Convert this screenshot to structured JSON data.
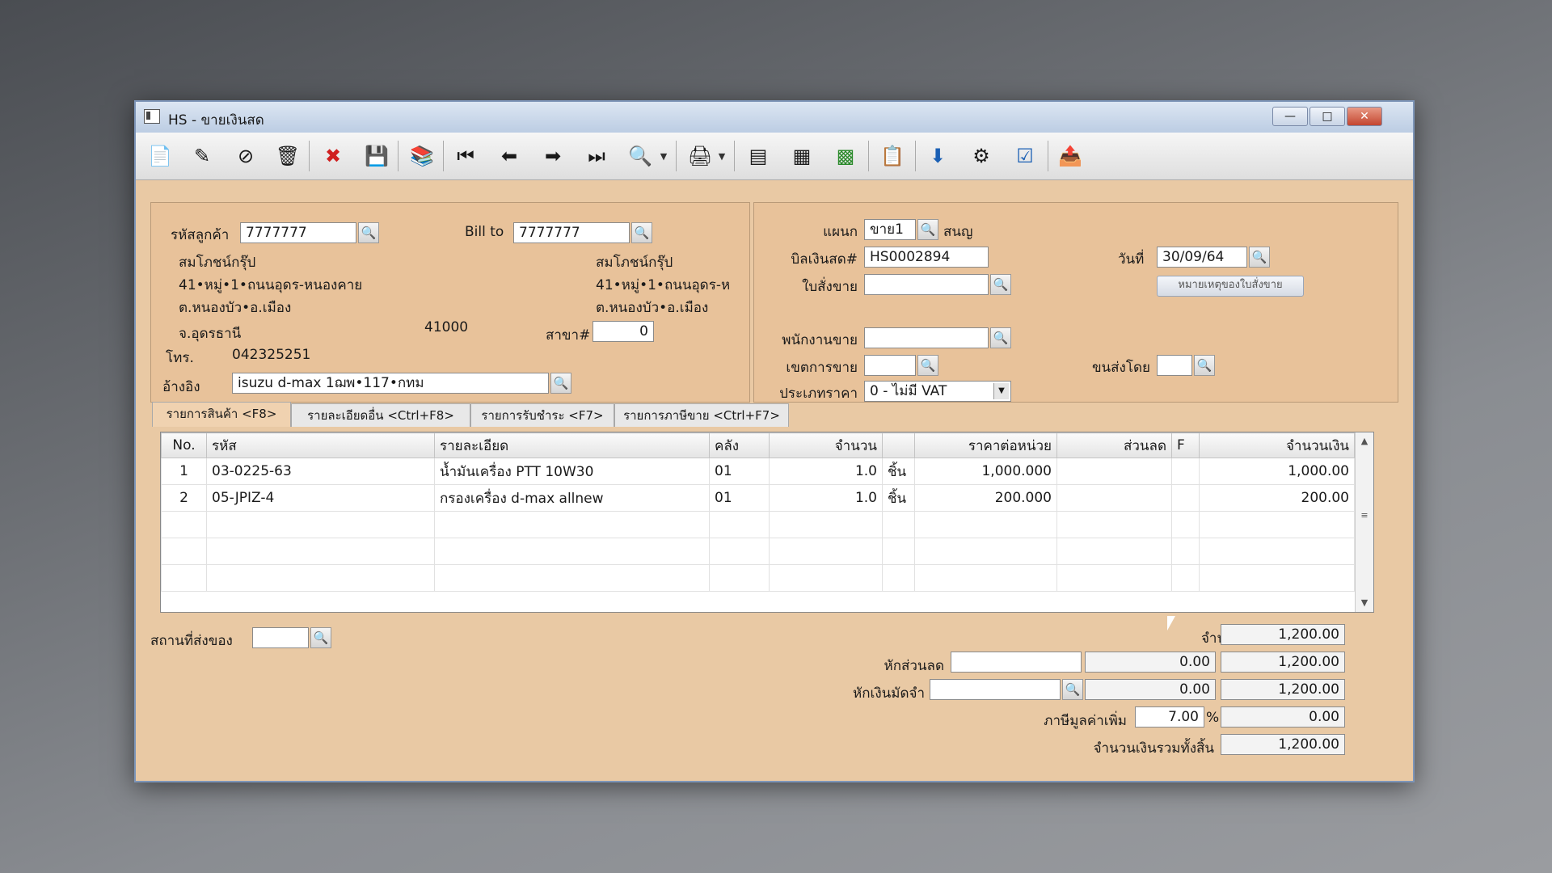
{
  "window": {
    "title": "HS - ขายเงินสด",
    "minimize": "—",
    "maximize": "□",
    "close": "✕"
  },
  "toolbar": {
    "icons": [
      "new-doc-icon",
      "edit-icon",
      "void-icon",
      "delete-icon",
      "cancel-icon",
      "save-icon",
      "copy-icon",
      "first-icon",
      "prev-icon",
      "next-icon",
      "last-icon",
      "find-icon",
      "dropdown-icon",
      "print-icon",
      "dropdown-icon",
      "calc1-icon",
      "calc2-icon",
      "calc3-icon",
      "report-icon",
      "ok-icon",
      "link-icon",
      "ok2-icon",
      "export-icon"
    ]
  },
  "customer": {
    "code_label": "รหัสลูกค้า",
    "code": "7777777",
    "bill_to_label": "Bill to",
    "bill_to": "7777777",
    "name": "สมโภชน์กรุ๊ป",
    "address1": "41•หมู่•1•ถนนอุดร-หนองคาย",
    "address2": "ต.หนองบัว•อ.เมือง",
    "province": "จ.อุดรธานี",
    "postcode": "41000",
    "bill_name": "สมโภชน์กรุ๊ป",
    "bill_address1": "41•หมู่•1•ถนนอุดร-ห",
    "bill_address2": "ต.หนองบัว•อ.เมือง",
    "branch_label": "สาขา#",
    "branch": "0",
    "phone_label": "โทร.",
    "phone": "042325251",
    "ref_label": "อ้างอิง",
    "ref": "isuzu d-max 1ฌพ•117•กทม"
  },
  "doc": {
    "dept_label": "แผนก",
    "dept": "ขาย1",
    "dept_name": "สนญ",
    "bill_no_label": "บิลเงินสด#",
    "bill_no": "HS0002894",
    "date_label": "วันที่",
    "date": "30/09/64",
    "order_label": "ใบสั่งขาย",
    "order": "",
    "order_note_button": "หมายเหตุของใบสั่งขาย",
    "sales_label": "พนักงานขาย",
    "sales": "",
    "zone_label": "เขตการขาย",
    "zone": "",
    "ship_label": "ขนส่งโดย",
    "ship": "",
    "price_type_label": "ประเภทราคา",
    "price_type": "0 - ไม่มี VAT"
  },
  "tabs": [
    "รายการสินค้า <F8>",
    "รายละเอียดอื่น <Ctrl+F8>",
    "รายการรับชำระ <F7>",
    "รายการภาษีขาย <Ctrl+F7>"
  ],
  "table": {
    "headers": [
      "No.",
      "รหัส",
      "รายละเอียด",
      "คลัง",
      "จำนวน",
      "",
      "ราคาต่อหน่วย",
      "ส่วนลด",
      "F",
      "จำนวนเงิน"
    ],
    "rows": [
      [
        "1",
        "03-0225-63",
        "น้ำมันเครื่อง PTT 10W30",
        "01",
        "1.0",
        "ชิ้น",
        "1,000.000",
        "",
        "",
        "1,000.00"
      ],
      [
        "2",
        "05-JPIZ-4",
        "กรองเครื่อง d-max allnew",
        "01",
        "1.0",
        "ชิ้น",
        "200.000",
        "",
        "",
        "200.00"
      ]
    ]
  },
  "footer": {
    "delivery_label": "สถานที่ส่งของ",
    "delivery": "",
    "amount_label": "จำนวนเงิน",
    "amount": "1,200.00",
    "discount_label": "หักส่วนลด",
    "discount": "",
    "discount_value": "0.00",
    "after_discount": "1,200.00",
    "deposit_label": "หักเงินมัดจำ",
    "deposit": "",
    "deposit_value": "0.00",
    "after_deposit": "1,200.00",
    "vat_label": "ภาษีมูลค่าเพิ่ม",
    "vat_rate": "7.00",
    "vat_pct": "%",
    "vat_amount": "0.00",
    "total_label": "จำนวนเงินรวมทั้งสิ้น",
    "total": "1,200.00"
  }
}
